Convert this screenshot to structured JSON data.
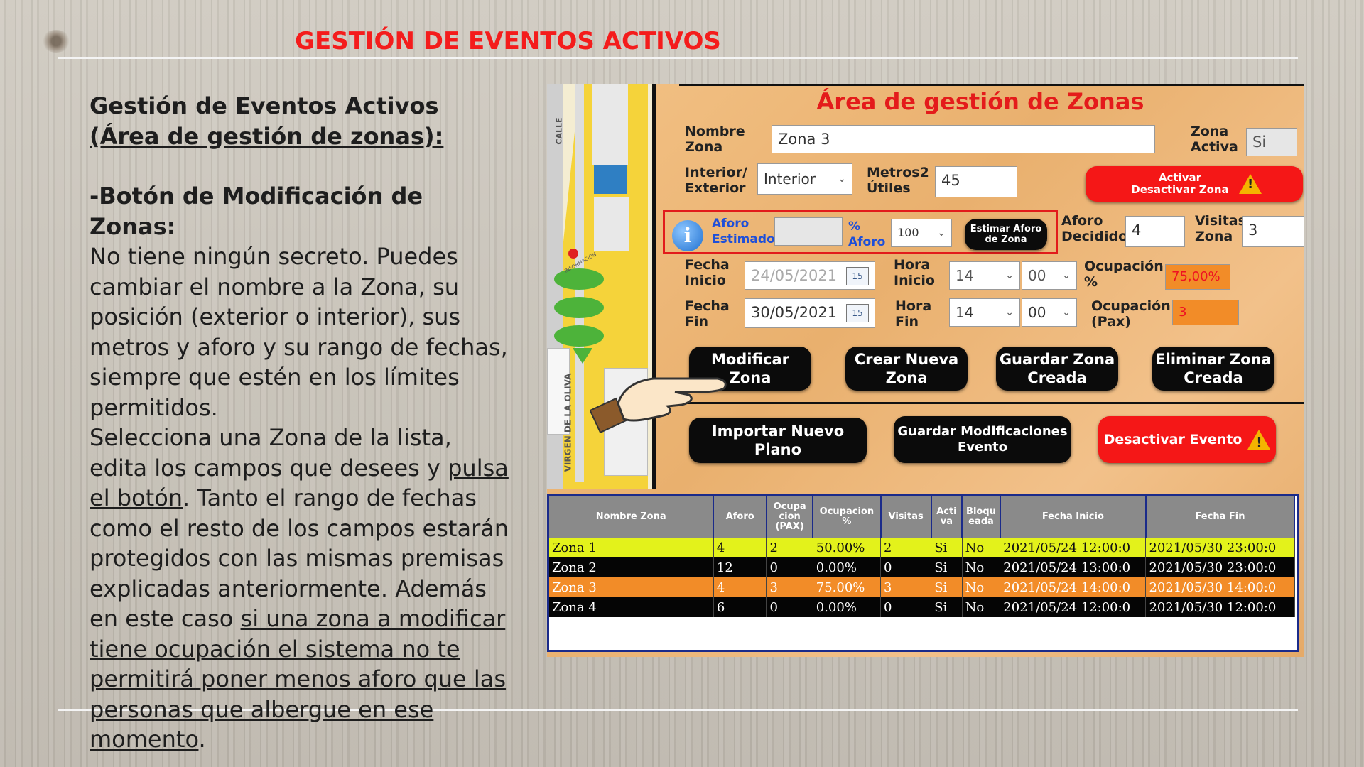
{
  "slide": {
    "title": "GESTIÓN DE EVENTOS ACTIVOS",
    "heading_a": "Gestión de Eventos Activos ",
    "heading_b": "(Área de gestión de zonas):",
    "sub_heading": "-Botón de Modificación de Zonas:",
    "p1": "No tiene ningún secreto. Puedes cambiar el nombre a la Zona, su posición (exterior o interior), sus metros y aforo y su rango de fechas, siempre que estén en los límites permitidos.",
    "p2a": "Selecciona una Zona de la lista, edita los campos que desees y ",
    "p2b": "pulsa el botón",
    "p2c": ". Tanto el rango de fechas como el resto de los campos estarán protegidos con las mismas premisas explicadas anteriormente. Además en este caso ",
    "p2d": "si una zona a modificar tiene ocupación el sistema no te permitirá poner menos aforo que las personas que albergue en ese momento",
    "p2e": "."
  },
  "app": {
    "title": "Área de gestión de Zonas",
    "labels": {
      "nombre": "Nombre Zona",
      "activa": "Zona Activa",
      "interior": "Interior/ Exterior",
      "metros": "Metros2 Útiles",
      "aforo_est": "Aforo Estimado",
      "pct_aforo": "% Aforo",
      "aforo_dec": "Aforo Decidido",
      "visitas": "Visitas Zona",
      "fecha_inicio": "Fecha Inicio",
      "hora_inicio": "Hora Inicio",
      "ocupacion_pct": "Ocupación %",
      "fecha_fin": "Fecha Fin",
      "hora_fin": "Hora Fin",
      "ocupacion_pax": "Ocupación (Pax)"
    },
    "fields": {
      "nombre": "Zona 3",
      "activa": "Si",
      "interior": "Interior",
      "metros": "45",
      "aforo_est": "",
      "pct_aforo": "100",
      "aforo_dec": "4",
      "visitas": "3",
      "fecha_inicio": "24/05/2021",
      "hora_inicio_h": "14",
      "hora_inicio_m": "00",
      "ocupacion_pct": "75,00%",
      "fecha_fin": "30/05/2021",
      "hora_fin_h": "14",
      "hora_fin_m": "00",
      "ocupacion_pax": "3",
      "calendar_day": "15"
    },
    "buttons": {
      "activar": "Activar Desactivar Zona",
      "estimar": "Estimar Aforo de Zona",
      "modificar": "Modificar Zona",
      "crear": "Crear Nueva Zona",
      "guardar": "Guardar Zona Creada",
      "eliminar": "Eliminar Zona Creada",
      "importar": "Importar Nuevo Plano",
      "guardar_mod": "Guardar Modificaciones Evento",
      "desactivar": "Desactivar Evento"
    },
    "map_labels": {
      "calle": "CALLE",
      "virgen": "VIRGEN DE LA OLIVA",
      "informacion": "INFORMACIÓN"
    },
    "table": {
      "headers": [
        "Nombre Zona",
        "Aforo",
        "Ocupa cion (PAX)",
        "Ocupacion %",
        "Visitas",
        "Acti va",
        "Bloqu eada",
        "Fecha Inicio",
        "Fecha Fin"
      ],
      "rows": [
        [
          "Zona 1",
          "4",
          "2",
          "50.00%",
          "2",
          "Si",
          "No",
          "2021/05/24 12:00:0",
          "2021/05/30 23:00:0"
        ],
        [
          "Zona 2",
          "12",
          "0",
          "0.00%",
          "0",
          "Si",
          "No",
          "2021/05/24 13:00:0",
          "2021/05/30 23:00:0"
        ],
        [
          "Zona 3",
          "4",
          "3",
          "75.00%",
          "3",
          "Si",
          "No",
          "2021/05/24 14:00:0",
          "2021/05/30 14:00:0"
        ],
        [
          "Zona 4",
          "6",
          "0",
          "0.00%",
          "0",
          "Si",
          "No",
          "2021/05/24 12:00:0",
          "2021/05/30 12:00:0"
        ]
      ]
    },
    "colors": {
      "accent_red": "#e41b1b",
      "row_selected": "#f28c28",
      "row_highlight": "#e3f21b"
    }
  }
}
